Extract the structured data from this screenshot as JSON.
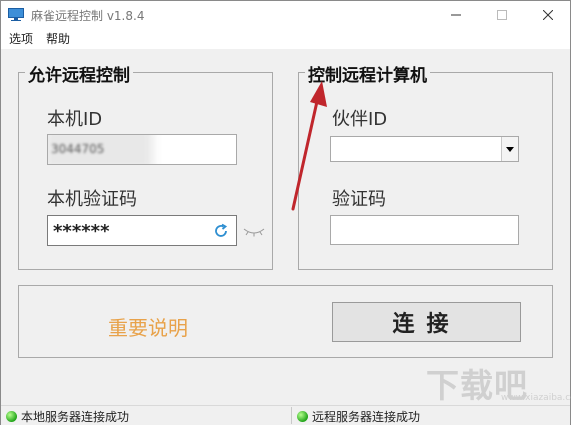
{
  "window": {
    "title": "麻雀远程控制 v1.8.4"
  },
  "menu": {
    "items": [
      "选项",
      "帮助"
    ]
  },
  "allow_group": {
    "title": "允许远程控制",
    "id_label": "本机ID",
    "id_value": "3044705",
    "code_label": "本机验证码",
    "code_value": "******"
  },
  "control_group": {
    "title": "控制远程计算机",
    "partner_label": "伙伴ID",
    "partner_value": "",
    "code_label": "验证码",
    "code_value": ""
  },
  "bottom": {
    "help_link": "重要说明",
    "connect_button": "连接"
  },
  "status": {
    "local": "本地服务器连接成功",
    "remote": "远程服务器连接成功"
  },
  "watermark": {
    "text": "下载吧",
    "sub": "www.xiazaiba.com"
  },
  "colors": {
    "help_link": "#e8a24a",
    "arrow": "#c0262c",
    "status_led": "#22a51a"
  }
}
